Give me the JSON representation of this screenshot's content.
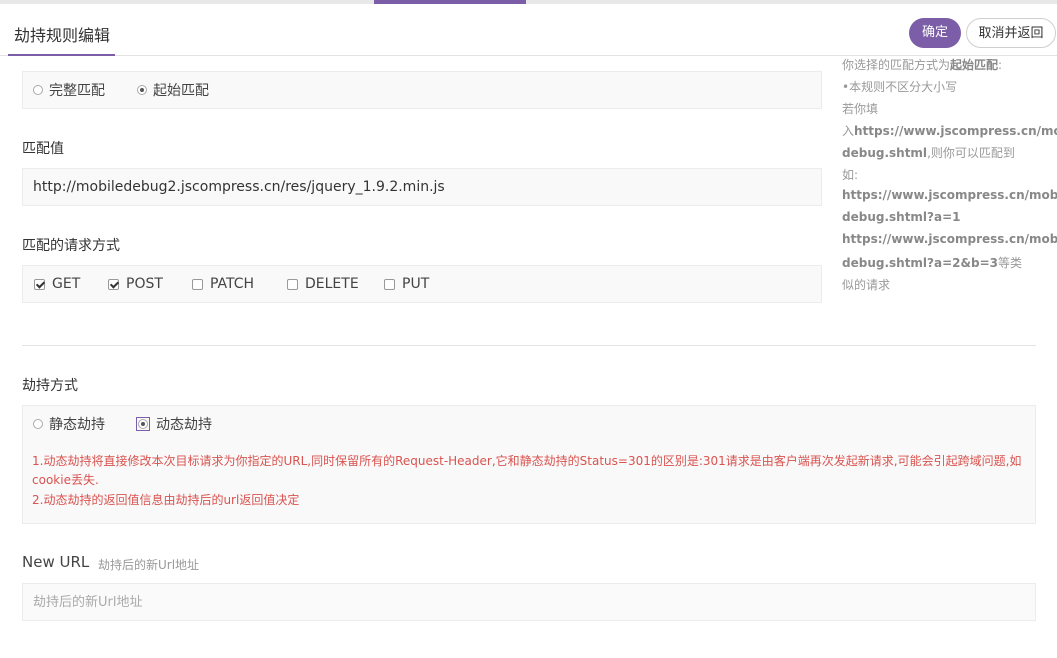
{
  "header": {
    "title": "劫持规则编辑",
    "confirm_label": "确定",
    "cancel_label": "取消并返回"
  },
  "match_mode": {
    "options": [
      {
        "label": "完整匹配",
        "selected": false
      },
      {
        "label": "起始匹配",
        "selected": true
      }
    ]
  },
  "match_value": {
    "label": "匹配值",
    "value": "http://mobiledebug2.jscompress.cn/res/jquery_1.9.2.min.js"
  },
  "methods": {
    "label": "匹配的请求方式",
    "items": [
      {
        "label": "GET",
        "checked": true
      },
      {
        "label": "POST",
        "checked": true
      },
      {
        "label": "PATCH",
        "checked": false
      },
      {
        "label": "DELETE",
        "checked": false
      },
      {
        "label": "PUT",
        "checked": false
      }
    ]
  },
  "hijack_mode": {
    "label": "劫持方式",
    "options": [
      {
        "label": "静态劫持",
        "selected": false
      },
      {
        "label": "动态劫持",
        "selected": true
      }
    ],
    "notes": [
      "1.动态劫持将直接修改本次目标请求为你指定的URL,同时保留所有的Request-Header,它和静态劫持的Status=301的区别是:301请求是由客户端再次发起新请求,可能会引起跨域问题,如",
      "cookie丢失.",
      "2.动态劫持的返回值信息由劫持后的url返回值决定"
    ]
  },
  "new_url": {
    "label": "New URL",
    "hint": "劫持后的新Url地址",
    "placeholder": "劫持后的新Url地址",
    "value": ""
  },
  "side_help": {
    "line1_prefix": "你选择的匹配方式为",
    "line1_mode": "起始匹配",
    "line1_suffix": ":",
    "line2": "•本规则不区分大小写",
    "line3": "若你填",
    "line4_prefix": "入",
    "line4_url": "https://www.jscompress.cn/mobile-",
    "line5_url": "debug.shtml",
    "line5_suffix": ",则你可以匹配到",
    "line6": "如:",
    "line7_url": "https://www.jscompress.cn/mobile-",
    "line8_url": "debug.shtml?a=1",
    "line9_url": "https://www.jscompress.cn/mobile-",
    "line10_url": "debug.shtml?a=2&b=3",
    "line10_suffix": "等类",
    "line11": "似的请求"
  },
  "colors": {
    "accent": "#7b5ea7",
    "warning": "#d9534f"
  }
}
